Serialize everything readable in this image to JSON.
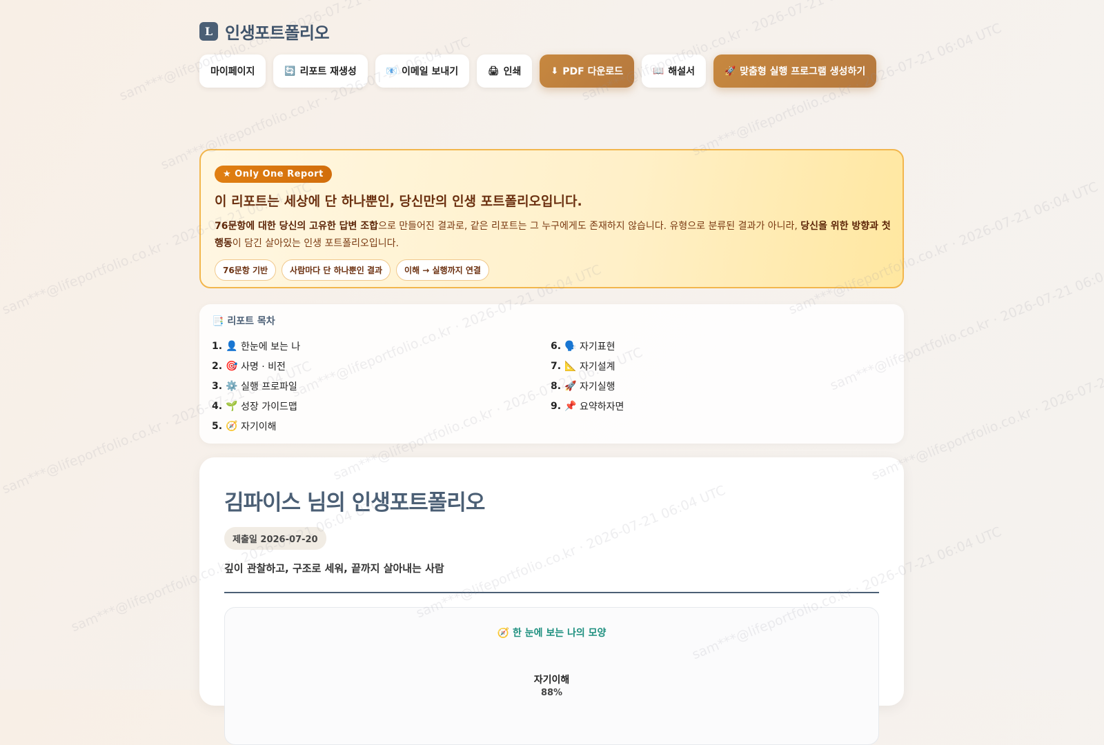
{
  "app": {
    "logo_letter": "L",
    "title": "인생포트폴리오"
  },
  "toolbar": {
    "mypage": "마이페이지",
    "regen": "리포트 재생성",
    "email": "이메일 보내기",
    "print": "인쇄",
    "pdf": "PDF 다운로드",
    "guide": "해설서",
    "program": "맞춤형 실행 프로그램 생성하기"
  },
  "hero": {
    "badge": "★ Only One Report",
    "title": "이 리포트는 세상에 단 하나뿐인, 당신만의 인생 포트폴리오입니다.",
    "desc": {
      "p1": "76문항에 대한 ",
      "b1": "당신의 고유한 답변 조합",
      "p2": "으로 만들어진 결과로, 같은 리포트는 그 누구에게도 존재하지 않습니다. 유형으로 분류된 결과가 아니라, ",
      "b2": "당신을 위한 방향과 첫 행동",
      "p3": "이 담긴 살아있는 인생 포트폴리오입니다."
    },
    "tags": [
      "76문항 기반",
      "사람마다 단 하나뿐인 결과",
      "이해 → 실행까지 연결"
    ]
  },
  "toc": {
    "title": "리포트 목차",
    "left": [
      {
        "num": "1.",
        "emoji": "👤",
        "label": "한눈에 보는 나"
      },
      {
        "num": "2.",
        "emoji": "🎯",
        "label": "사명 · 비전"
      },
      {
        "num": "3.",
        "emoji": "⚙️",
        "label": "실행 프로파일"
      },
      {
        "num": "4.",
        "emoji": "🌱",
        "label": "성장 가이드맵"
      },
      {
        "num": "5.",
        "emoji": "🧭",
        "label": "자기이해"
      }
    ],
    "right": [
      {
        "num": "6.",
        "emoji": "🗣️",
        "label": "자기표현"
      },
      {
        "num": "7.",
        "emoji": "📐",
        "label": "자기설계"
      },
      {
        "num": "8.",
        "emoji": "🚀",
        "label": "자기실행"
      },
      {
        "num": "9.",
        "emoji": "📌",
        "label": "요약하자면"
      }
    ]
  },
  "report": {
    "title": "김파이스 님의 인생포트폴리오",
    "date": "제출일 2026-07-20",
    "subtitle": "깊이 관찰하고, 구조로 세워, 끝까지 살아내는 사람",
    "shape_title": "한 눈에 보는 나의 모양",
    "axis_label": "자기이해",
    "axis_value": "88%"
  },
  "watermark": "sam***@lifeportfolio.co.kr · 2026-07-21 06:04 UTC",
  "colors": {
    "accent": "#c7883f",
    "brand": "#4b5f75",
    "hero_border": "#f2b64c",
    "teal": "#1c8f7e"
  }
}
